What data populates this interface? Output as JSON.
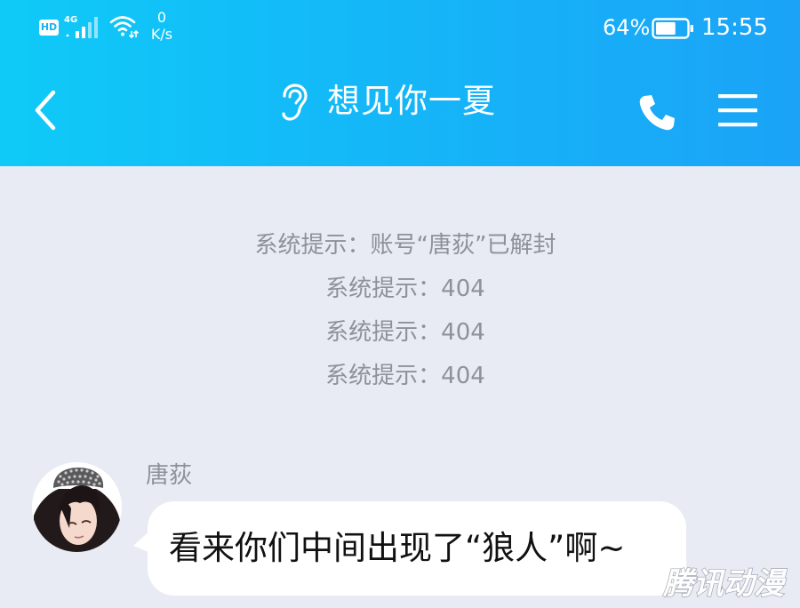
{
  "status_bar": {
    "hd_label": "HD",
    "network_type": "4G",
    "net_speed_value": "0",
    "net_speed_unit": "K/s",
    "battery_percent": "64%",
    "battery_level": 0.64,
    "time": "15:55"
  },
  "header": {
    "title": "想见你一夏",
    "left_icon": "back-chevron-icon",
    "title_icon": "ear-icon",
    "right_icons": [
      "phone-icon",
      "menu-icon"
    ]
  },
  "system_notices": [
    "系统提示：账号“唐荻”已解封",
    "系统提示：404",
    "系统提示：404",
    "系统提示：404"
  ],
  "message": {
    "sender": "唐荻",
    "text": "看来你们中间出现了“狼人”啊~"
  },
  "watermark": {
    "text": "腾讯动漫"
  },
  "colors": {
    "header_gradient_start": "#0fcaf7",
    "header_gradient_end": "#1ba3f7",
    "chat_background": "#e8ebf4",
    "system_text": "#8d9198",
    "bubble": "#ffffff"
  }
}
